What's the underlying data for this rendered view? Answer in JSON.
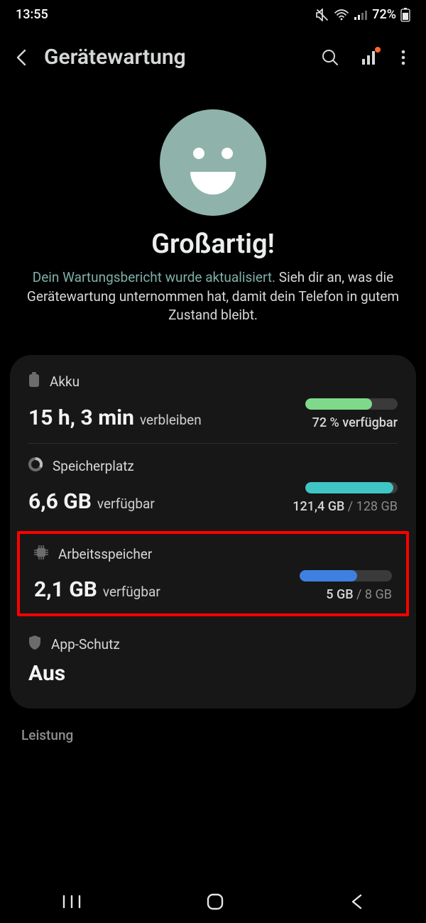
{
  "statusbar": {
    "time": "13:55",
    "battery_pct": "72%"
  },
  "header": {
    "title": "Gerätewartung"
  },
  "hero": {
    "title": "Großartig!",
    "subtitle_accent": "Dein Wartungsbericht wurde aktualisiert.",
    "subtitle_rest": " Sieh dir an, was die Gerätewartung unternommen hat, damit dein Telefon in gutem Zustand bleibt."
  },
  "rows": {
    "battery": {
      "label": "Akku",
      "value": "15 h, 3 min",
      "suffix": "verbleiben",
      "side": "72 % verfügbar",
      "bar_pct": 72,
      "bar_color": "#7fd98a"
    },
    "storage": {
      "label": "Speicherplatz",
      "value": "6,6 GB",
      "suffix": "verfügbar",
      "side_main": "121,4 GB",
      "side_dim": " / 128 GB",
      "bar_pct": 95,
      "bar_color": "#3fc5c3"
    },
    "memory": {
      "label": "Arbeitsspeicher",
      "value": "2,1 GB",
      "suffix": "verfügbar",
      "side_main": "5 GB",
      "side_dim": " / 8 GB",
      "bar_pct": 62,
      "bar_color": "#3f7fe0"
    },
    "appsec": {
      "label": "App-Schutz",
      "value": "Aus"
    }
  },
  "section": {
    "performance": "Leistung"
  }
}
